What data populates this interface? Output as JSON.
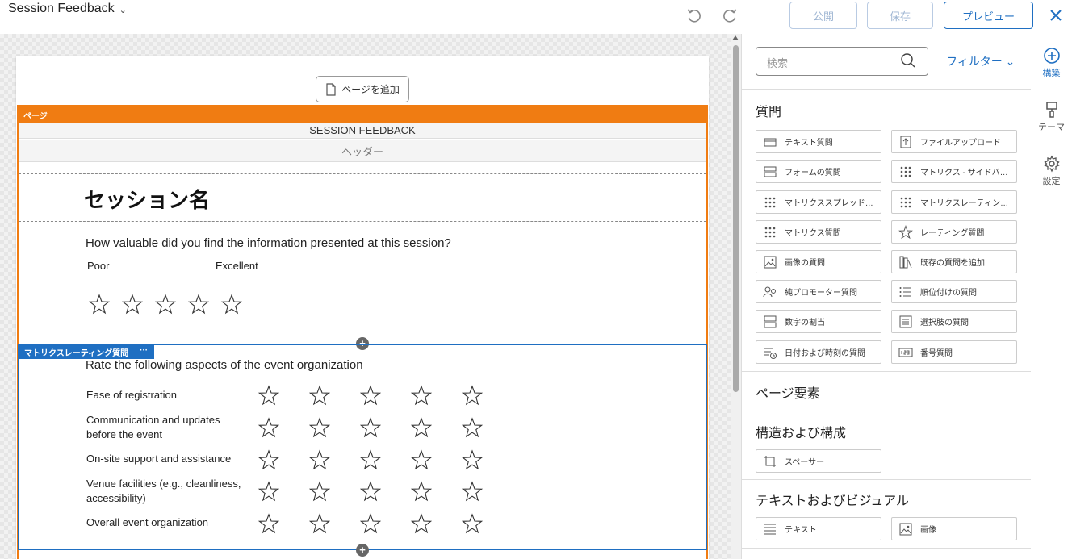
{
  "topbar": {
    "title": "Session Feedback",
    "publish_label": "公開",
    "save_label": "保存",
    "preview_label": "プレビュー"
  },
  "canvas": {
    "add_page_label": "ページを追加",
    "page_tag": "ページ",
    "session_title": "SESSION FEEDBACK",
    "header_label": "ヘッダー",
    "session_name": "セッション名",
    "question1": {
      "text": "How valuable did you find the information presented at this session?",
      "low_label": "Poor",
      "high_label": "Excellent",
      "star_count": 5
    },
    "matrix": {
      "tag_label": "マトリクスレーティング質問",
      "tag_more": "···",
      "title": "Rate the following aspects of the event organization",
      "rows": [
        "Ease of registration",
        "Communication and updates before the event",
        "On-site support and assistance",
        "Venue facilities (e.g., cleanliness, accessibility)",
        "Overall event organization"
      ],
      "star_count": 5
    }
  },
  "panel": {
    "search_placeholder": "検索",
    "filter_label": "フィルター",
    "questions_heading": "質問",
    "question_items": [
      {
        "label": "テキスト質問",
        "icon": "text-question-icon"
      },
      {
        "label": "ファイルアップロード",
        "icon": "file-upload-icon"
      },
      {
        "label": "フォームの質問",
        "icon": "form-question-icon"
      },
      {
        "label": "マトリクス - サイドバ…",
        "icon": "matrix-side-icon"
      },
      {
        "label": "マトリクススプレッド…",
        "icon": "matrix-spreadsheet-icon"
      },
      {
        "label": "マトリクスレーティン…",
        "icon": "matrix-rating-icon"
      },
      {
        "label": "マトリクス質問",
        "icon": "matrix-question-icon"
      },
      {
        "label": "レーティング質問",
        "icon": "star-icon"
      },
      {
        "label": "画像の質問",
        "icon": "image-question-icon"
      },
      {
        "label": "既存の質問を追加",
        "icon": "existing-question-icon"
      },
      {
        "label": "純プロモーター質問",
        "icon": "promoter-icon"
      },
      {
        "label": "順位付けの質問",
        "icon": "ranking-icon"
      },
      {
        "label": "数字の割当",
        "icon": "number-allocation-icon"
      },
      {
        "label": "選択肢の質問",
        "icon": "choice-question-icon"
      },
      {
        "label": "日付および時刻の質問",
        "icon": "date-time-icon"
      },
      {
        "label": "番号質問",
        "icon": "number-question-icon"
      }
    ],
    "page_elements_heading": "ページ要素",
    "structure_heading": "構造および構成",
    "spacer_label": "スペーサー",
    "text_visual_heading": "テキストおよびビジュアル",
    "text_label": "テキスト",
    "image_label": "画像"
  },
  "rail": {
    "build_label": "構築",
    "theme_label": "テーマ",
    "settings_label": "設定"
  },
  "colors": {
    "accent": "#1f6fc2",
    "page_orange": "#f07c12"
  }
}
